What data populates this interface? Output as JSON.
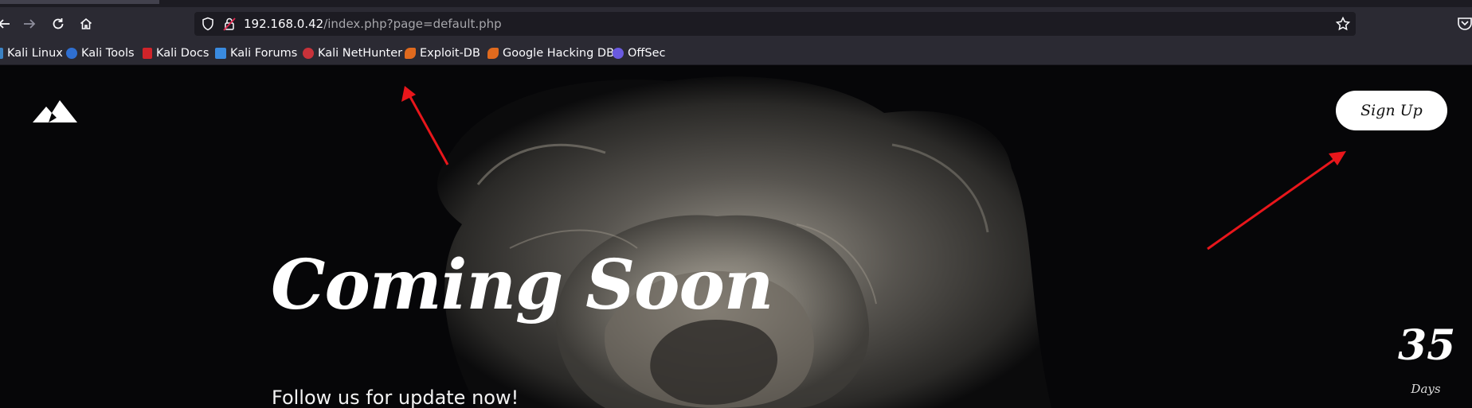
{
  "browser": {
    "url_host": "192.168.0.42",
    "url_path": "/index.php?page=default.php",
    "bookmarks": [
      {
        "label": "Kali Linux",
        "color": "#3b82c4"
      },
      {
        "label": "Kali Tools",
        "color": "#2f6fd1"
      },
      {
        "label": "Kali Docs",
        "color": "#d0242a"
      },
      {
        "label": "Kali Forums",
        "color": "#3a8be0"
      },
      {
        "label": "Kali NetHunter",
        "color": "#c8323a"
      },
      {
        "label": "Exploit-DB",
        "color": "#e06a1e"
      },
      {
        "label": "Google Hacking DB",
        "color": "#e06a1e"
      },
      {
        "label": "OffSec",
        "color": "#6a5ae0"
      }
    ]
  },
  "page": {
    "signup_label": "Sign Up",
    "hero_title": "Coming Soon",
    "hero_subtitle": "Follow us for update now!",
    "countdown_value": "35",
    "countdown_unit": "Days"
  },
  "colors": {
    "annotation_arrow": "#e8161b",
    "background": "#060608"
  }
}
